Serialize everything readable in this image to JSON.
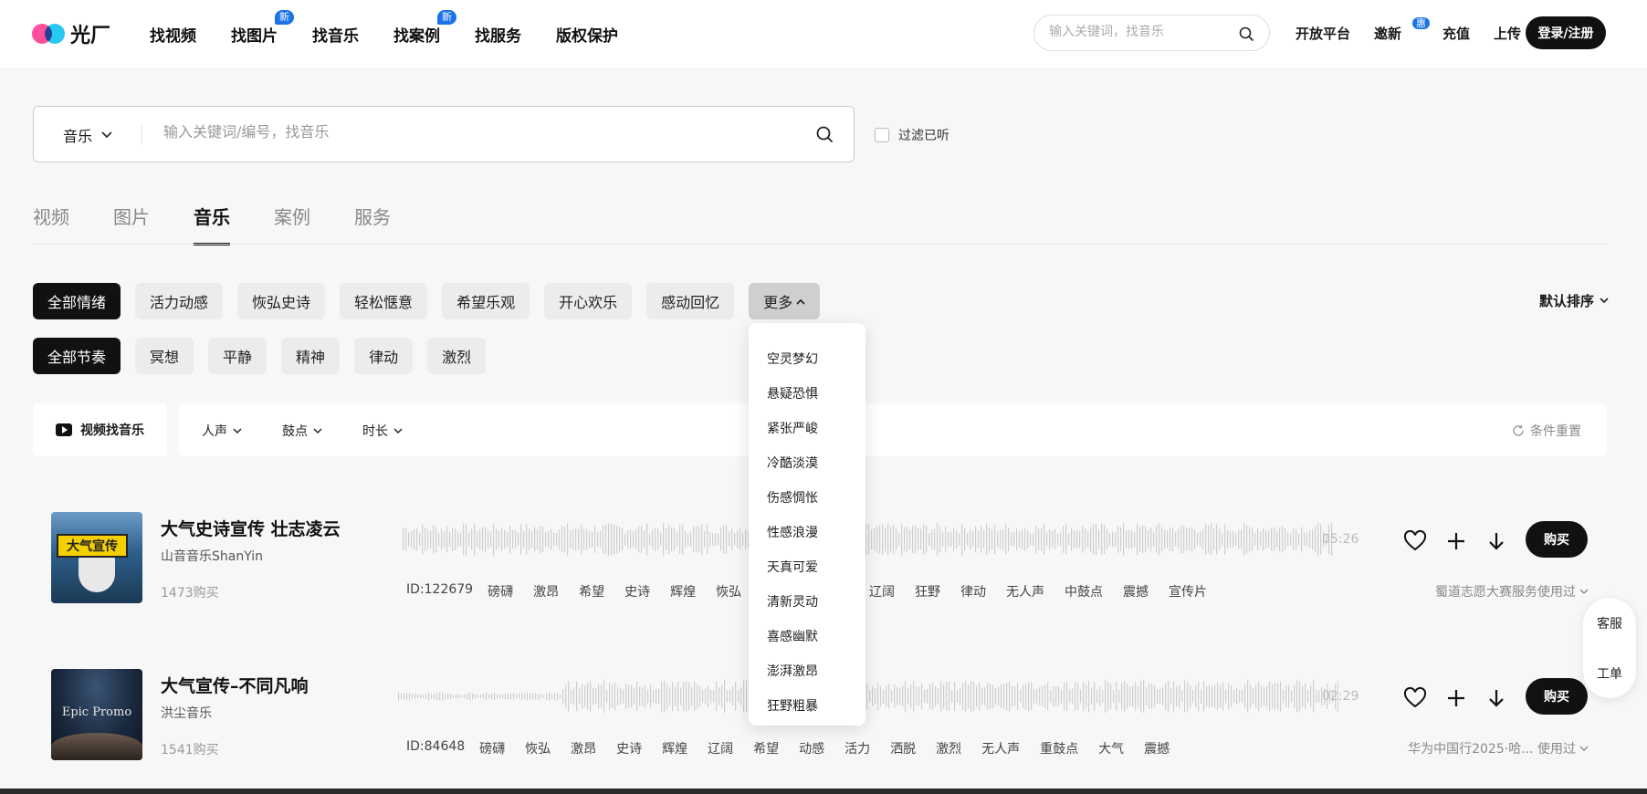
{
  "header": {
    "logo_text": "光厂",
    "nav": [
      {
        "label": "找视频",
        "badge": ""
      },
      {
        "label": "找图片",
        "badge": "新"
      },
      {
        "label": "找音乐",
        "badge": ""
      },
      {
        "label": "找案例",
        "badge": "新"
      },
      {
        "label": "找服务",
        "badge": ""
      },
      {
        "label": "版权保护",
        "badge": ""
      }
    ],
    "search_placeholder": "输入关键词，找音乐",
    "links": {
      "open_platform": "开放平台",
      "invite": "邀新",
      "invite_badge": "惠",
      "recharge": "充值",
      "upload": "上传"
    },
    "login": "登录/注册"
  },
  "search": {
    "type": "音乐",
    "placeholder": "输入关键词/编号，找音乐",
    "filter_listened": "过滤已听"
  },
  "tabs": [
    "视频",
    "图片",
    "音乐",
    "案例",
    "服务"
  ],
  "active_tab": "音乐",
  "moods": [
    "全部情绪",
    "活力动感",
    "恢弘史诗",
    "轻松惬意",
    "希望乐观",
    "开心欢乐",
    "感动回忆"
  ],
  "more_label": "更多",
  "rhythms": [
    "全部节奏",
    "冥想",
    "平静",
    "精神",
    "律动",
    "激烈"
  ],
  "sort_label": "默认排序",
  "toolbar": {
    "video_find": "视频找音乐",
    "vocal": "人声",
    "drum": "鼓点",
    "duration": "时长",
    "reset": "条件重置"
  },
  "more_dropdown": [
    "空灵梦幻",
    "悬疑恐惧",
    "紧张严峻",
    "冷酷淡漠",
    "伤感惆怅",
    "性感浪漫",
    "天真可爱",
    "清新灵动",
    "喜感幽默",
    "澎湃激昂",
    "狂野粗暴"
  ],
  "tracks": [
    {
      "title": "大气史诗宣传 壮志凌云",
      "artist": "山音音乐ShanYin",
      "purchases": "1473购买",
      "duration": "05:26",
      "id": "ID:122679",
      "tags_left": [
        "磅礴",
        "激昂",
        "希望",
        "史诗",
        "辉煌",
        "恢弘"
      ],
      "tags_right": [
        "辽阔",
        "狂野",
        "律动",
        "无人声",
        "中鼓点",
        "震撼",
        "宣传片"
      ],
      "used_by": "蜀道志愿大赛服务使用过",
      "cover_text": "大气宣传",
      "buy": "购买"
    },
    {
      "title": "大气宣传–不同凡响",
      "artist": "洪尘音乐",
      "purchases": "1541购买",
      "duration": "02:29",
      "id": "ID:84648",
      "tags": [
        "磅礴",
        "恢弘",
        "激昂",
        "史诗",
        "辉煌",
        "辽阔",
        "希望",
        "动感",
        "活力",
        "洒脱",
        "激烈",
        "无人声",
        "重鼓点",
        "大气",
        "震撼"
      ],
      "used_by": "华为中国行2025·哈... 使用过",
      "cover_text": "Epic Promo",
      "buy": "购买"
    }
  ],
  "side_float": {
    "service": "客服",
    "ticket": "工单"
  }
}
